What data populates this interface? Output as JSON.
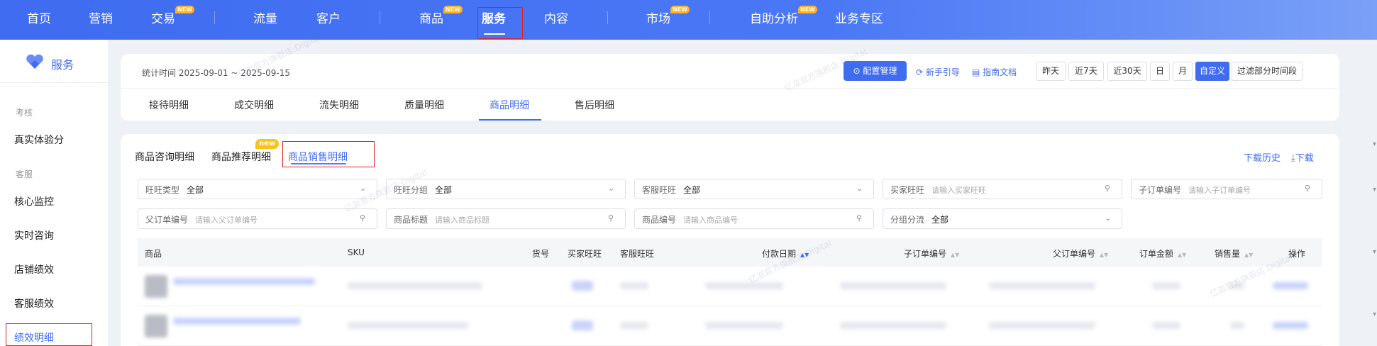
{
  "topnav": {
    "items": [
      {
        "label": "首页",
        "new": false
      },
      {
        "label": "营销",
        "new": false
      },
      {
        "label": "交易",
        "new": true
      },
      {
        "label": "流量",
        "new": false
      },
      {
        "label": "客户",
        "new": false
      },
      {
        "label": "商品",
        "new": true
      },
      {
        "label": "服务",
        "new": false
      },
      {
        "label": "内容",
        "new": false
      },
      {
        "label": "市场",
        "new": true
      },
      {
        "label": "自助分析",
        "new": true
      },
      {
        "label": "业务专区",
        "new": false
      }
    ],
    "new_badge": "NEW",
    "active": "服务"
  },
  "sidebar": {
    "title": "服务",
    "groups": [
      {
        "label": "考核"
      },
      {
        "label": "客服"
      }
    ],
    "items": [
      {
        "label": "真实体验分"
      },
      {
        "label": "核心监控"
      },
      {
        "label": "实时咨询"
      },
      {
        "label": "店铺绩效"
      },
      {
        "label": "客服绩效"
      },
      {
        "label": "绩效明细"
      }
    ]
  },
  "header": {
    "stat_time": "统计时间 2025-09-01 ~ 2025-09-15",
    "config_btn": "配置管理",
    "guide_link": "新手引导",
    "doc_link": "指南文档",
    "ranges": [
      "昨天",
      "近7天",
      "近30天",
      "日",
      "月",
      "自定义"
    ],
    "active_range": "自定义",
    "filter_time": "过滤部分时间段"
  },
  "tabs": [
    "接待明细",
    "成交明细",
    "流失明细",
    "质量明细",
    "商品明细",
    "售后明细"
  ],
  "active_tab": "商品明细",
  "subtabs": [
    "商品咨询明细",
    "商品推荐明细",
    "商品销售明细"
  ],
  "subtab_new": "new",
  "download_history": "下载历史",
  "download": "下载",
  "filters": {
    "wangwang_type": {
      "label": "旺旺类型",
      "value": "全部"
    },
    "wangwang_group": {
      "label": "旺旺分组",
      "value": "全部"
    },
    "cs_wangwang": {
      "label": "客服旺旺",
      "value": "全部"
    },
    "buyer_wangwang": {
      "label": "买家旺旺",
      "placeholder": "请输入买家旺旺"
    },
    "sub_order": {
      "label": "子订单编号",
      "placeholder": "请输入子订单编号"
    },
    "parent_order": {
      "label": "父订单编号",
      "placeholder": "请输入父订单编号"
    },
    "product_title": {
      "label": "商品标题",
      "placeholder": "请输入商品标题"
    },
    "product_code": {
      "label": "商品编号",
      "placeholder": "请输入商品编号"
    },
    "group_flow": {
      "label": "分组分流",
      "value": "全部"
    }
  },
  "table": {
    "columns": [
      "商品",
      "SKU",
      "货号",
      "买家旺旺",
      "客服旺旺",
      "付款日期",
      "子订单编号",
      "父订单编号",
      "订单金额",
      "销售量",
      "操作"
    ]
  },
  "watermark": "亿滋官方旗舰店:Digital",
  "colors": {
    "accent": "#3f6cf0",
    "highlight": "#e02020",
    "badge": "#ffb21f"
  }
}
